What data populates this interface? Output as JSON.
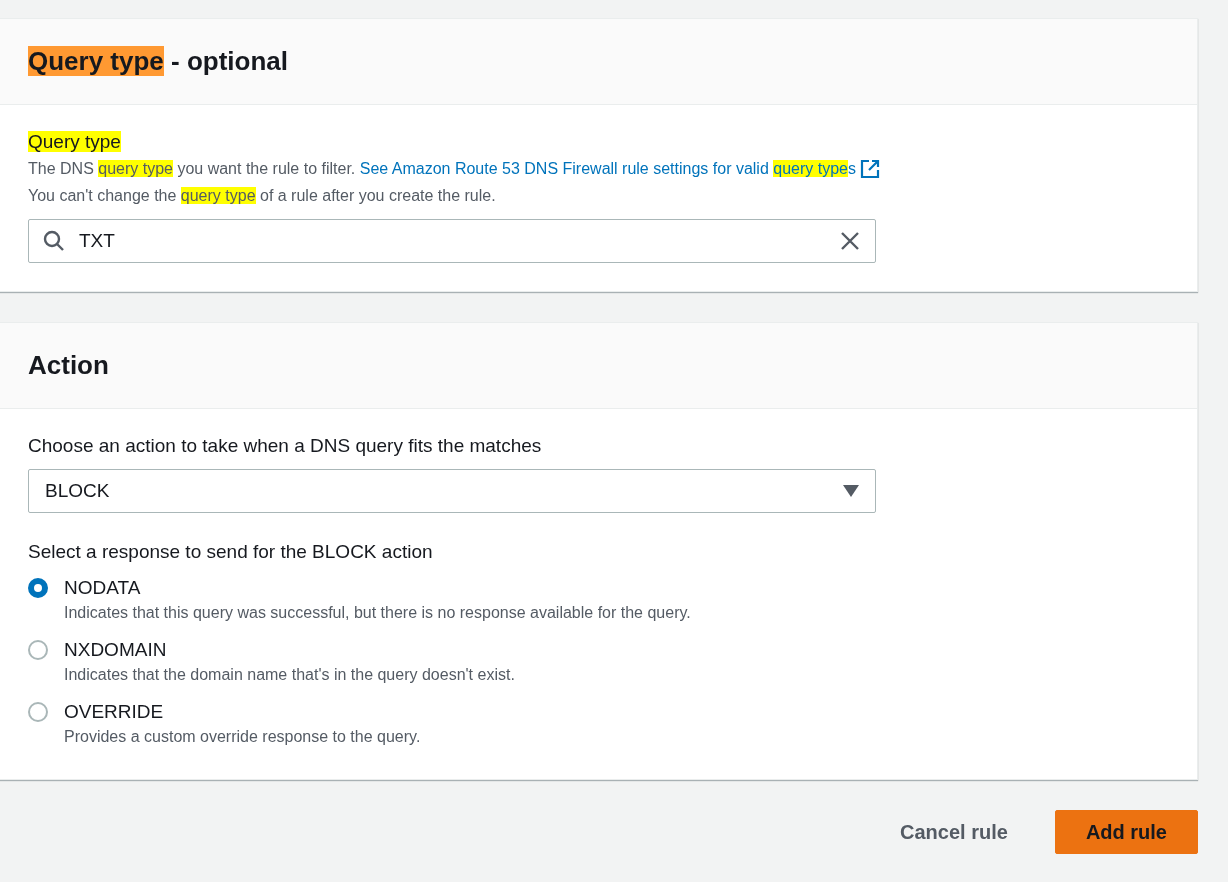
{
  "sections": [
    {
      "kind": "query_type",
      "title": [
        {
          "text": "Query type",
          "highlighted": true,
          "current": true
        },
        {
          "text": " - optional",
          "highlighted": false
        }
      ],
      "field_label": [
        {
          "text": "Query type",
          "highlighted": true
        }
      ],
      "description": [
        [
          {
            "text": "The DNS ",
            "highlighted": false
          },
          {
            "text": "query type",
            "highlighted": true
          },
          {
            "text": " you want the rule to filter. ",
            "highlighted": false
          },
          {
            "kind": "link",
            "parts": [
              {
                "text": "See Amazon Route 53 DNS Firewall rule settings for valid ",
                "highlighted": false
              },
              {
                "text": "query type",
                "highlighted": true
              },
              {
                "text": "s",
                "highlighted": false
              }
            ]
          }
        ],
        [
          {
            "text": "You can't change the ",
            "highlighted": false
          },
          {
            "text": "query type",
            "highlighted": true
          },
          {
            "text": " of a rule after you create the rule.",
            "highlighted": false
          }
        ]
      ],
      "search": {
        "value": "TXT"
      }
    },
    {
      "kind": "action",
      "title": [
        {
          "text": "Action",
          "highlighted": false
        }
      ],
      "select_label": "Choose an action to take when a DNS query fits the matches",
      "select": {
        "value": "BLOCK"
      },
      "radio_label": "Select a response to send for the BLOCK action",
      "options": [
        {
          "label": "NODATA",
          "description": "Indicates that this query was successful, but there is no response available for the query.",
          "selected": true
        },
        {
          "label": "NXDOMAIN",
          "description": "Indicates that the domain name that's in the query doesn't exist.",
          "selected": false
        },
        {
          "label": "OVERRIDE",
          "description": "Provides a custom override response to the query.",
          "selected": false
        }
      ]
    }
  ],
  "buttons": [
    {
      "label": "Cancel rule",
      "kind": "link"
    },
    {
      "label": "Add rule",
      "kind": "primary"
    }
  ]
}
